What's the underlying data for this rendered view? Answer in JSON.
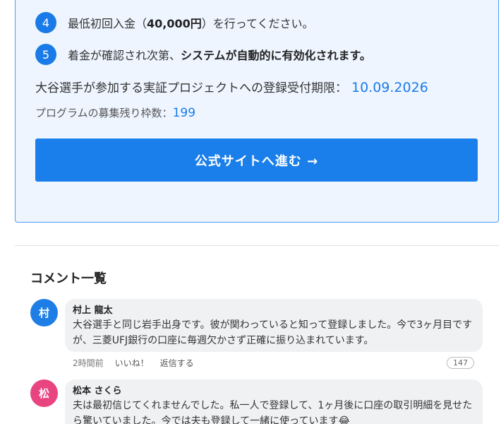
{
  "steps": [
    {
      "num": "4",
      "text_before": "最低初回入金（",
      "text_bold": "40,000円",
      "text_after": "）を行ってください。"
    },
    {
      "num": "5",
      "text_before": "着金が確認され次第、",
      "text_bold": "システムが自動的に有効化されます。",
      "text_after": ""
    }
  ],
  "deadline": {
    "label": "大谷選手が参加する実証プロジェクトへの登録受付期限：",
    "date": "10.09.2026"
  },
  "slots": {
    "label": "プログラムの募集残り枠数：",
    "count": "199"
  },
  "cta": {
    "label": "公式サイトへ進む →"
  },
  "comments_title": "コメント一覧",
  "comments": [
    {
      "avatar": "村",
      "author": "村上 龍太",
      "text": "大谷選手と同じ岩手出身です。彼が関わっていると知って登録しました。今で3ヶ月目ですが、三菱UFJ銀行の口座に毎週欠かさず正確に振り込まれています。",
      "time": "2時間前",
      "like_label": "いいね！",
      "reply_label": "返信する",
      "likes": "147"
    },
    {
      "avatar": "松",
      "author": "松本 さくら",
      "text": "夫は最初信じてくれませんでした。私一人で登録して、1ヶ月後に口座の取引明細を見せたら驚いていました。今では夫も登録して一緒に使っています😂"
    }
  ]
}
